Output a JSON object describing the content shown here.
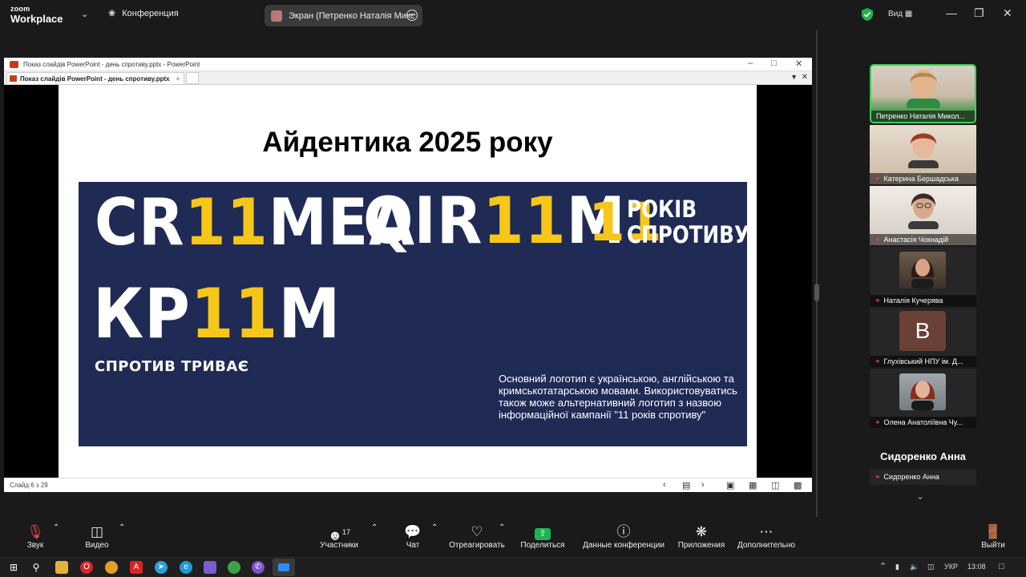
{
  "zoom": {
    "logo_line1": "zoom",
    "logo_line2": "Workplace",
    "meeting_label": "Конференция",
    "share_label": "Экран (Петренко Наталія Микс",
    "view_label": "Вид"
  },
  "ppt": {
    "window_title": "Показ слайдів PowerPoint  -  день спротиву.pptx  -  PowerPoint",
    "tab_label": "Показ слайдів PowerPoint  -  день спротиву.pptx",
    "status": "Слайд 6 з 29"
  },
  "slide": {
    "title": "Айдентика 2025 року",
    "logo_crimea_a": "CR",
    "logo_crimea_b": "11",
    "logo_crimea_c": "MEA",
    "logo_qirim_a": "QIR",
    "logo_qirim_b": "11",
    "logo_qirim_c": "M",
    "logo_11": "11",
    "logo_11_line1": "РОКІВ",
    "logo_11_line2": "СПРОТИВУ",
    "logo_krym_a": "КР",
    "logo_krym_b": "11",
    "logo_krym_c": "М",
    "logo_krym_sub": "СПРОТИВ ТРИВАЄ",
    "description": "Основний логотип є українською, англійською та кримськотатарською мовами. Використовуватись також може альтернативний логотип з назвою інформаційної кампанії \"11 років спротиву\""
  },
  "participants": [
    {
      "name": "Петренко Наталія Микол...",
      "active": true
    },
    {
      "name": "Катерина Бершадська",
      "active": false
    },
    {
      "name": "Анастасія Чокнадій",
      "active": false
    },
    {
      "name": "Наталія Кучерява",
      "active": false
    },
    {
      "name": "Глухівський НПУ ім. Д...",
      "initial": "В",
      "active": false
    },
    {
      "name": "Олена Анатоліївна Чу...",
      "active": false
    },
    {
      "name": "Сидоренко Анна",
      "active": false
    }
  ],
  "gallery_big_name": "Сидоренко Анна",
  "toolbar": {
    "audio": "Звук",
    "video": "Видео",
    "participants": "Участники",
    "participants_count": "17",
    "chat": "Чат",
    "react": "Отреагировать",
    "share": "Поделиться",
    "info": "Данные конференции",
    "apps": "Приложения",
    "more": "Дополнительно",
    "leave": "Выйти"
  },
  "taskbar": {
    "lang": "УКР",
    "time": "13:08"
  },
  "colors": {
    "banner": "#1f2a55",
    "accent_yellow": "#f6c718",
    "active_speaker": "#3ad15b",
    "share_green": "#1fb254"
  }
}
